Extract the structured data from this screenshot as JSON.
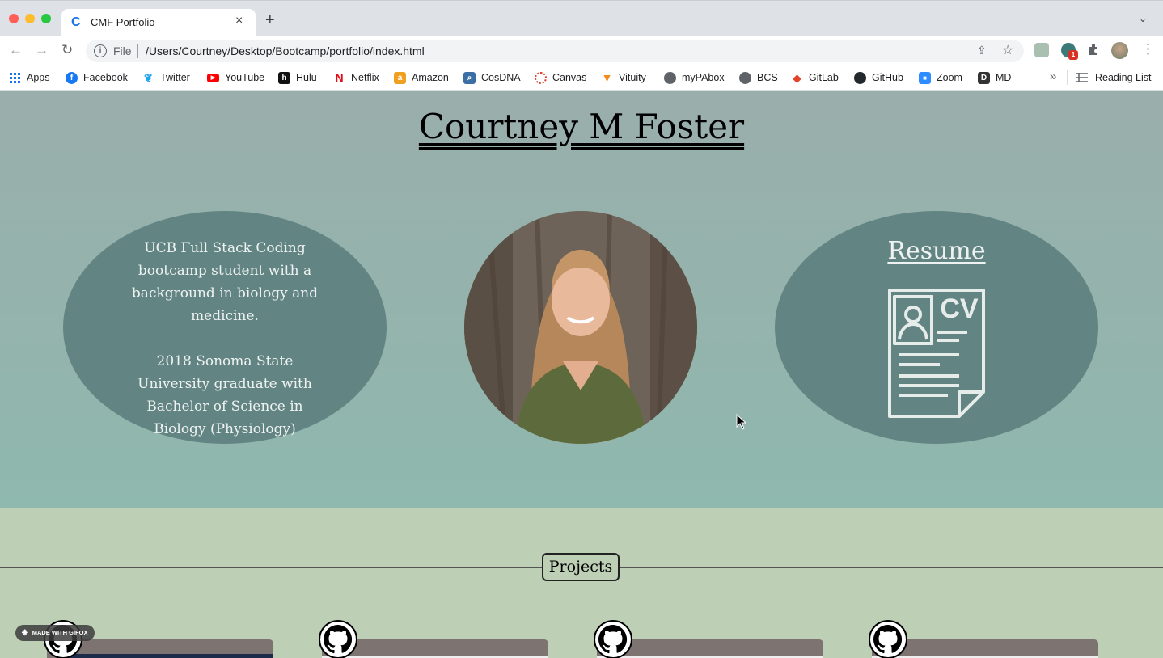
{
  "browser": {
    "tab": {
      "favicon": "C",
      "title": "CMF Portfolio",
      "close": "×"
    },
    "new_tab": "+",
    "tab_dropdown": "⌄",
    "nav": {
      "back": "←",
      "forward": "→",
      "reload": "↻"
    },
    "omnibox": {
      "info": "i",
      "scheme_label": "File",
      "url": "/Users/Courtney/Desktop/Bootcamp/portfolio/index.html",
      "share": "⇪",
      "star": "☆"
    },
    "extensions": {
      "ext_badge": "1",
      "menu": "⋮"
    },
    "bookmarks": [
      {
        "label": "Apps",
        "icon": "apps-grid-icon",
        "color": "#1a73e8"
      },
      {
        "label": "Facebook",
        "icon": "facebook-icon",
        "color": "#1877f2"
      },
      {
        "label": "Twitter",
        "icon": "twitter-icon",
        "color": "#1da1f2"
      },
      {
        "label": "YouTube",
        "icon": "youtube-icon",
        "color": "#ff0000"
      },
      {
        "label": "Hulu",
        "icon": "hulu-icon",
        "color": "#111111"
      },
      {
        "label": "Netflix",
        "icon": "netflix-icon",
        "color": "#e50914"
      },
      {
        "label": "Amazon",
        "icon": "amazon-icon",
        "color": "#f0a020"
      },
      {
        "label": "CosDNA",
        "icon": "cosdna-icon",
        "color": "#3a6ea5"
      },
      {
        "label": "Canvas",
        "icon": "canvas-icon",
        "color": "#e13f2b"
      },
      {
        "label": "Vituity",
        "icon": "vituity-icon",
        "color": "#f28a1d"
      },
      {
        "label": "myPAbox",
        "icon": "globe-icon",
        "color": "#5f6368"
      },
      {
        "label": "BCS",
        "icon": "globe-icon",
        "color": "#5f6368"
      },
      {
        "label": "GitLab",
        "icon": "gitlab-icon",
        "color": "#e24329"
      },
      {
        "label": "GitHub",
        "icon": "github-icon",
        "color": "#24292e"
      },
      {
        "label": "Zoom",
        "icon": "zoom-icon",
        "color": "#2d8cff"
      },
      {
        "label": "MD",
        "icon": "md-icon",
        "color": "#333333"
      }
    ],
    "bookmarks_overflow": "»",
    "reading_list": "Reading List"
  },
  "page": {
    "title": "Courtney M Foster",
    "bio": {
      "line1": "UCB Full Stack Coding bootcamp student with a background in biology and medicine.",
      "line2": "2018 Sonoma State University graduate with Bachelor of Science in Biology (Physiology)"
    },
    "photo_alt": "Portrait",
    "resume": {
      "label": "Resume",
      "icon_text": "CV"
    },
    "projects": {
      "label": "Projects",
      "cards": 4
    },
    "watermark": "MADE WITH GIFOX",
    "colors": {
      "hero_top": "#9aaeab",
      "hero_bottom": "#8fb8ae",
      "oval": "#628584",
      "projects_bg": "#bdcfb5"
    }
  }
}
